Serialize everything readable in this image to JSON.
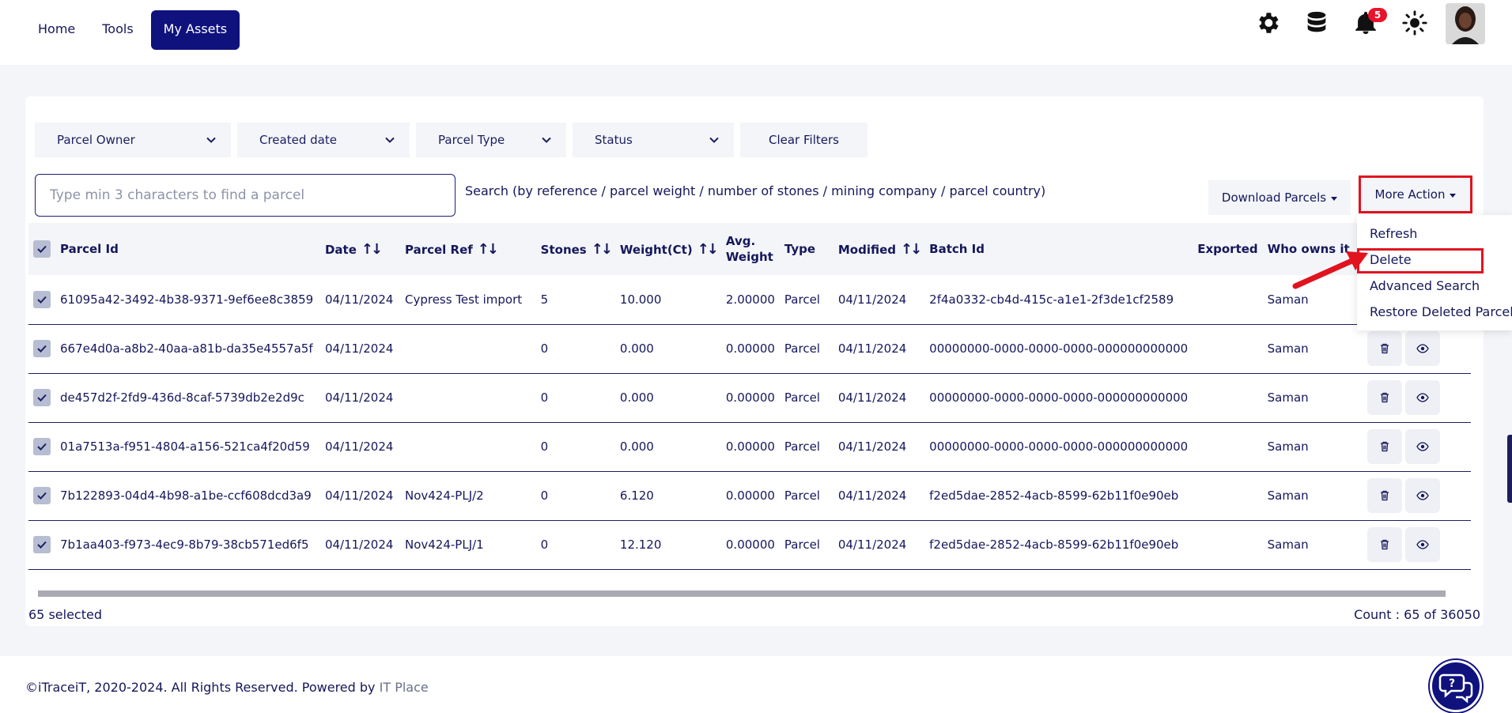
{
  "nav": {
    "home": "Home",
    "tools": "Tools",
    "assets": "My Assets"
  },
  "header": {
    "notifications_count": "5"
  },
  "filters": {
    "owner": "Parcel Owner",
    "created": "Created date",
    "type": "Parcel Type",
    "status": "Status",
    "clear": "Clear Filters"
  },
  "search": {
    "placeholder": "Type min 3 characters to find a parcel",
    "hint": "Search (by reference / parcel weight / number of stones / mining company / parcel country)"
  },
  "actions": {
    "download": "Download Parcels",
    "more": "More Action"
  },
  "menu": {
    "refresh": "Refresh",
    "delete": "Delete",
    "advanced": "Advanced Search",
    "restore": "Restore Deleted Parcel"
  },
  "table": {
    "headers": {
      "id": "Parcel Id",
      "date": "Date",
      "ref": "Parcel Ref",
      "stones": "Stones",
      "weight": "Weight(Ct)",
      "avg1": "Avg.",
      "avg2": "Weight",
      "type": "Type",
      "modified": "Modified",
      "batch": "Batch Id",
      "exported": "Exported",
      "owner": "Who owns it"
    },
    "rows": [
      {
        "id": "61095a42-3492-4b38-9371-9ef6ee8c3859",
        "date": "04/11/2024",
        "ref": "Cypress Test import",
        "stones": "5",
        "weight": "10.000",
        "avg": "2.00000",
        "type": "Parcel",
        "modified": "04/11/2024",
        "batch": "2f4a0332-cb4d-415c-a1e1-2f3de1cf2589",
        "owner": "Saman"
      },
      {
        "id": "667e4d0a-a8b2-40aa-a81b-da35e4557a5f",
        "date": "04/11/2024",
        "ref": "",
        "stones": "0",
        "weight": "0.000",
        "avg": "0.00000",
        "type": "Parcel",
        "modified": "04/11/2024",
        "batch": "00000000-0000-0000-0000-000000000000",
        "owner": "Saman"
      },
      {
        "id": "de457d2f-2fd9-436d-8caf-5739db2e2d9c",
        "date": "04/11/2024",
        "ref": "",
        "stones": "0",
        "weight": "0.000",
        "avg": "0.00000",
        "type": "Parcel",
        "modified": "04/11/2024",
        "batch": "00000000-0000-0000-0000-000000000000",
        "owner": "Saman"
      },
      {
        "id": "01a7513a-f951-4804-a156-521ca4f20d59",
        "date": "04/11/2024",
        "ref": "",
        "stones": "0",
        "weight": "0.000",
        "avg": "0.00000",
        "type": "Parcel",
        "modified": "04/11/2024",
        "batch": "00000000-0000-0000-0000-000000000000",
        "owner": "Saman"
      },
      {
        "id": "7b122893-04d4-4b98-a1be-ccf608dcd3a9",
        "date": "04/11/2024",
        "ref": "Nov424-PLJ/2",
        "stones": "0",
        "weight": "6.120",
        "avg": "0.00000",
        "type": "Parcel",
        "modified": "04/11/2024",
        "batch": "f2ed5dae-2852-4acb-8599-62b11f0e90eb",
        "owner": "Saman"
      },
      {
        "id": "7b1aa403-f973-4ec9-8b79-38cb571ed6f5",
        "date": "04/11/2024",
        "ref": "Nov424-PLJ/1",
        "stones": "0",
        "weight": "12.120",
        "avg": "0.00000",
        "type": "Parcel",
        "modified": "04/11/2024",
        "batch": "f2ed5dae-2852-4acb-8599-62b11f0e90eb",
        "owner": "Saman"
      }
    ]
  },
  "status": {
    "selected": "65 selected",
    "count": "Count : 65 of 36050"
  },
  "footer": {
    "copyright": "©iTraceiT, 2020-2024. All Rights Reserved. Powered by ",
    "powered": "IT Place"
  }
}
